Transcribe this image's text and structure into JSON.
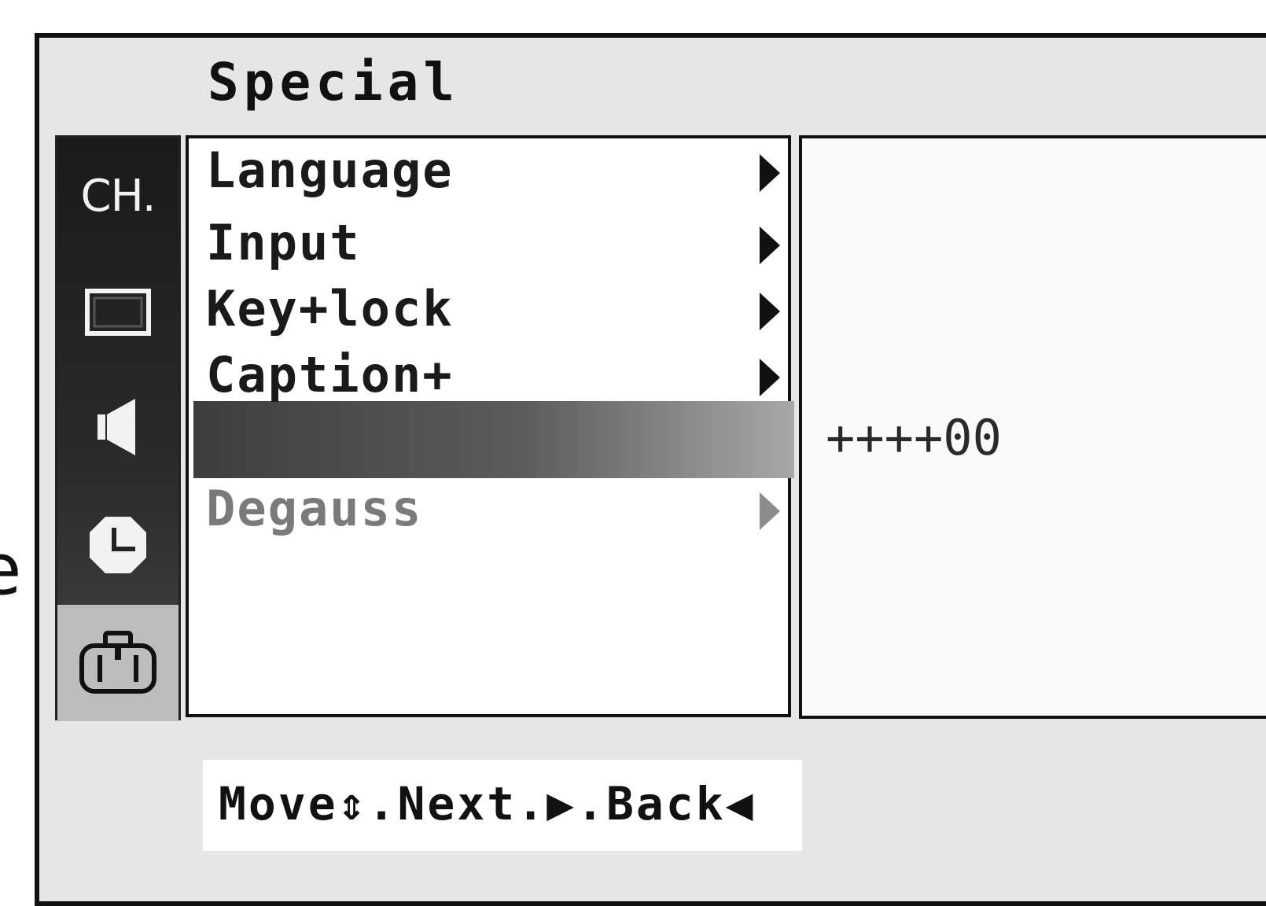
{
  "osd": {
    "title": "Special",
    "rail": [
      {
        "icon": "channel",
        "label": "CH."
      },
      {
        "icon": "picture-icon"
      },
      {
        "icon": "speaker-icon"
      },
      {
        "icon": "clock-icon"
      },
      {
        "icon": "toolbox-icon",
        "selected": true
      }
    ],
    "menu": [
      {
        "label": "Language",
        "state": "normal"
      },
      {
        "label": "Input",
        "state": "normal"
      },
      {
        "label": "Key+lock",
        "state": "normal"
      },
      {
        "label": "Caption+",
        "state": "normal"
      },
      {
        "label": "",
        "state": "highlighted"
      },
      {
        "label": "Degauss",
        "state": "disabled"
      }
    ],
    "value": "++++00",
    "hint": "Move⇕.Next.▶.Back◀"
  }
}
